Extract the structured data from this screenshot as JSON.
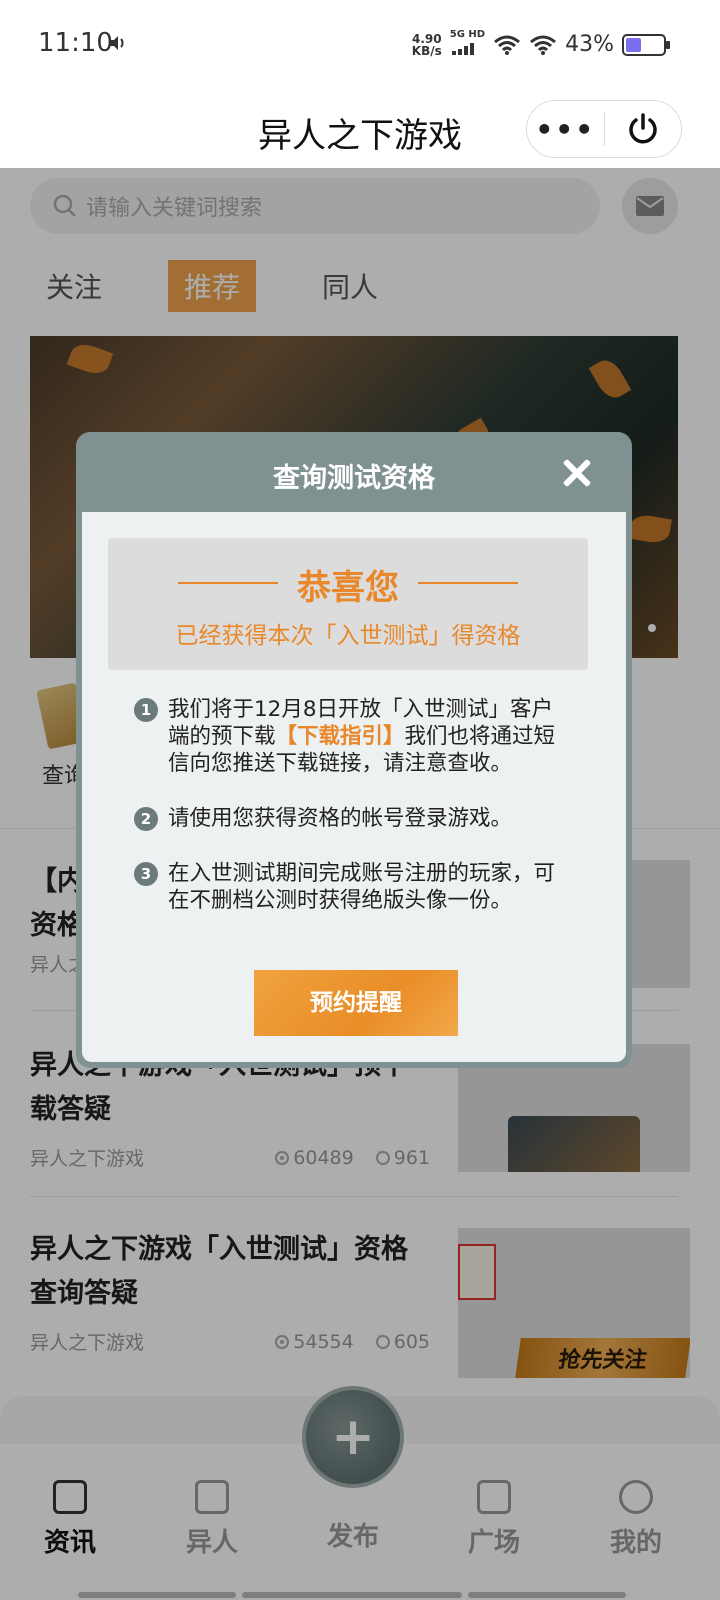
{
  "status_bar": {
    "time": "11:10",
    "speed_value": "4.90",
    "speed_unit": "KB/s",
    "network": "5G HD",
    "battery_text": "43%",
    "battery_level": 0.43,
    "battery_color": "#7b6ff0"
  },
  "header": {
    "title": "异人之下游戏",
    "more_label": "•••"
  },
  "search": {
    "placeholder": "请输入关键词搜索"
  },
  "tabs": [
    {
      "label": "关注"
    },
    {
      "label": "推荐"
    },
    {
      "label": "同人"
    }
  ],
  "active_tab_color": "#f0a34c",
  "quick_entry": {
    "label": "查询"
  },
  "articles": [
    {
      "title_part1": "【内",
      "title_part2": "资格",
      "source": "异人之"
    },
    {
      "title": "异人之下游戏「入世测试」预下载答疑",
      "source": "异人之下游戏",
      "views": "60489",
      "comments": "961"
    },
    {
      "title": "异人之下游戏「入世测试」资格查询答疑",
      "source": "异人之下游戏",
      "views": "54554",
      "comments": "605",
      "thumb_cta": "抢先关注"
    }
  ],
  "tabbar": [
    {
      "label": "资讯"
    },
    {
      "label": "异人"
    },
    {
      "label": "发布"
    },
    {
      "label": "广场"
    },
    {
      "label": "我的"
    }
  ],
  "fab_label": "+",
  "modal": {
    "title": "查询测试资格",
    "congrats_title": "恭喜您",
    "congrats_sub": "已经获得本次「入世测试」得资格",
    "steps": [
      {
        "num": "1",
        "text_before": "我们将于12月8日开放「入世测试」客户端的预下载",
        "link": "【下载指引】",
        "text_after": "我们也将通过短信向您推送下载链接，请注意查收。"
      },
      {
        "num": "2",
        "text": "请使用您获得资格的帐号登录游戏。"
      },
      {
        "num": "3",
        "text": "在入世测试期间完成账号注册的玩家，可在不删档公测时获得绝版头像一份。"
      }
    ],
    "button_label": "预约提醒",
    "accent_color": "#e8882b",
    "header_color": "#7f9190"
  }
}
